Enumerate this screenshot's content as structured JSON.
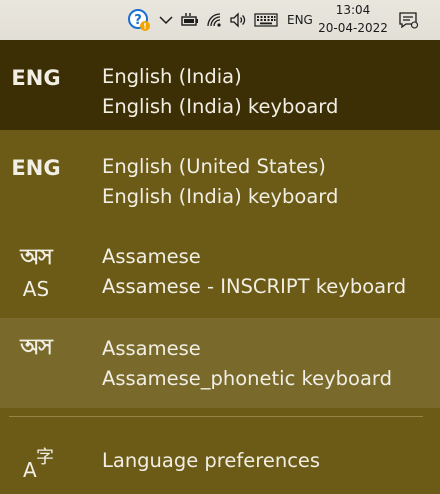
{
  "taskbar": {
    "tray_icons": [
      "help-badge-icon",
      "chevron-up-icon",
      "battery-charging-icon",
      "wifi-icon",
      "volume-icon",
      "keyboard-icon"
    ],
    "input_indicator": "ENG",
    "time": "13:04",
    "date": "20-04-2022",
    "notification_icon": "action-center-icon"
  },
  "flyout": {
    "languages": [
      {
        "abbr": "ENG",
        "abbr_sub": "",
        "language": "English (India)",
        "keyboard": "English (India) keyboard",
        "state": "selected"
      },
      {
        "abbr": "ENG",
        "abbr_sub": "",
        "language": "English (United States)",
        "keyboard": "English (India) keyboard",
        "state": "normal"
      },
      {
        "abbr": "অস",
        "abbr_sub": "AS",
        "language": "Assamese",
        "keyboard": "Assamese - INSCRIPT keyboard",
        "state": "normal"
      },
      {
        "abbr": "অস",
        "abbr_sub": "",
        "language": "Assamese",
        "keyboard": "Assamese_phonetic keyboard",
        "state": "hover"
      }
    ],
    "preferences_label": "Language preferences",
    "preferences_icon": "language-icon"
  },
  "colors": {
    "flyout_background": "#6b5b17",
    "selected_item": "#3c2f05",
    "hover_item": "#796a2c",
    "taskbar": "#e6e3db",
    "text": "#f1eee4"
  }
}
